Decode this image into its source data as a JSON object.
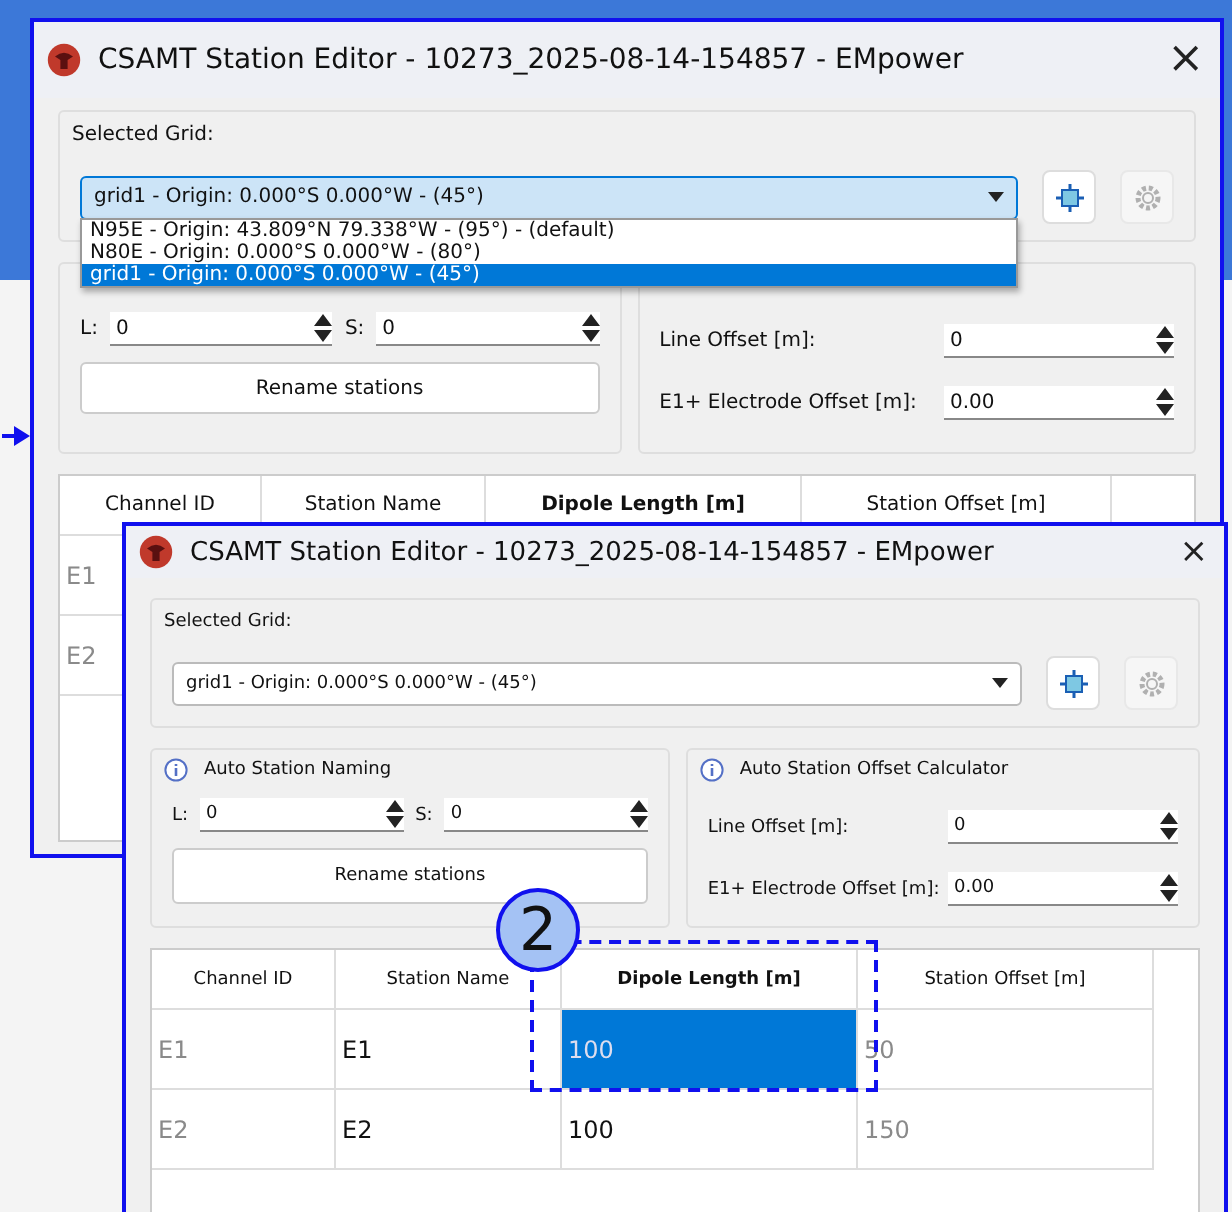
{
  "windows": [
    {
      "title": "CSAMT Station Editor - 10273_2025-08-14-154857 - EMpower",
      "close": "×",
      "grid": {
        "label": "Selected Grid:",
        "dropdown": {
          "value": "grid1 - Origin: 0.000°S 0.000°W - (45°)",
          "expanded": true,
          "options": [
            {
              "label": "N95E - Origin: 43.809°N 79.338°W - (95°) - (default)",
              "selected": false
            },
            {
              "label": "N80E - Origin: 0.000°S 0.000°W - (80°)",
              "selected": false
            },
            {
              "label": "grid1 - Origin: 0.000°S 0.000°W - (45°)",
              "selected": true
            }
          ]
        },
        "buttons": [
          {
            "kind": "grid",
            "disabled": false
          },
          {
            "kind": "settings",
            "disabled": true
          }
        ]
      },
      "naming": {
        "fields": [
          {
            "label": "L:",
            "value": "0"
          },
          {
            "label": "S:",
            "value": "0"
          }
        ],
        "button": "Rename stations"
      },
      "offsets": {
        "fields": [
          {
            "label": "Line Offset [m]:",
            "value": "0"
          },
          {
            "label": "E1+ Electrode Offset [m]:",
            "value": "0.00"
          }
        ]
      },
      "table": {
        "columns": [
          {
            "label": "Channel ID",
            "selected": false,
            "readonly": true
          },
          {
            "label": "Station Name",
            "selected": false
          },
          {
            "label": "Dipole Length [m]",
            "selected": true
          },
          {
            "label": "Station Offset [m]",
            "selected": false
          }
        ],
        "rows": [
          {
            "cells": [
              {
                "text": "E1",
                "selected": false
              }
            ]
          },
          {
            "cells": [
              {
                "text": "E2",
                "selected": false
              }
            ]
          }
        ]
      }
    },
    {
      "title": "CSAMT Station Editor - 10273_2025-08-14-154857 - EMpower",
      "close": "×",
      "grid": {
        "label": "Selected Grid:",
        "dropdown": {
          "value": "grid1 - Origin: 0.000°S 0.000°W - (45°)",
          "expanded": false
        },
        "buttons": [
          {
            "kind": "grid",
            "disabled": false
          },
          {
            "kind": "settings",
            "disabled": true
          }
        ]
      },
      "naming": {
        "title": "Auto Station Naming",
        "fields": [
          {
            "label": "L:",
            "value": "0"
          },
          {
            "label": "S:",
            "value": "0"
          }
        ],
        "button": "Rename stations"
      },
      "offsets": {
        "title": "Auto Station Offset Calculator",
        "fields": [
          {
            "label": "Line Offset [m]:",
            "value": "0"
          },
          {
            "label": "E1+ Electrode Offset [m]:",
            "value": "0.00"
          }
        ]
      },
      "table": {
        "columns": [
          {
            "label": "Channel ID",
            "selected": false,
            "readonly": true
          },
          {
            "label": "Station Name",
            "selected": false,
            "readonly": false
          },
          {
            "label": "Dipole Length [m]",
            "selected": true,
            "readonly": false
          },
          {
            "label": "Station Offset [m]",
            "selected": false,
            "readonly": true
          }
        ],
        "rows": [
          {
            "cells": [
              {
                "text": "E1",
                "selected": false
              },
              {
                "text": "E1",
                "selected": false
              },
              {
                "text": "100",
                "selected": true
              },
              {
                "text": "50",
                "selected": false
              }
            ]
          },
          {
            "cells": [
              {
                "text": "E2",
                "selected": false
              },
              {
                "text": "E2",
                "selected": false
              },
              {
                "text": "100",
                "selected": false
              },
              {
                "text": "150",
                "selected": false
              }
            ]
          }
        ]
      }
    }
  ],
  "callout": {
    "number": "2"
  }
}
